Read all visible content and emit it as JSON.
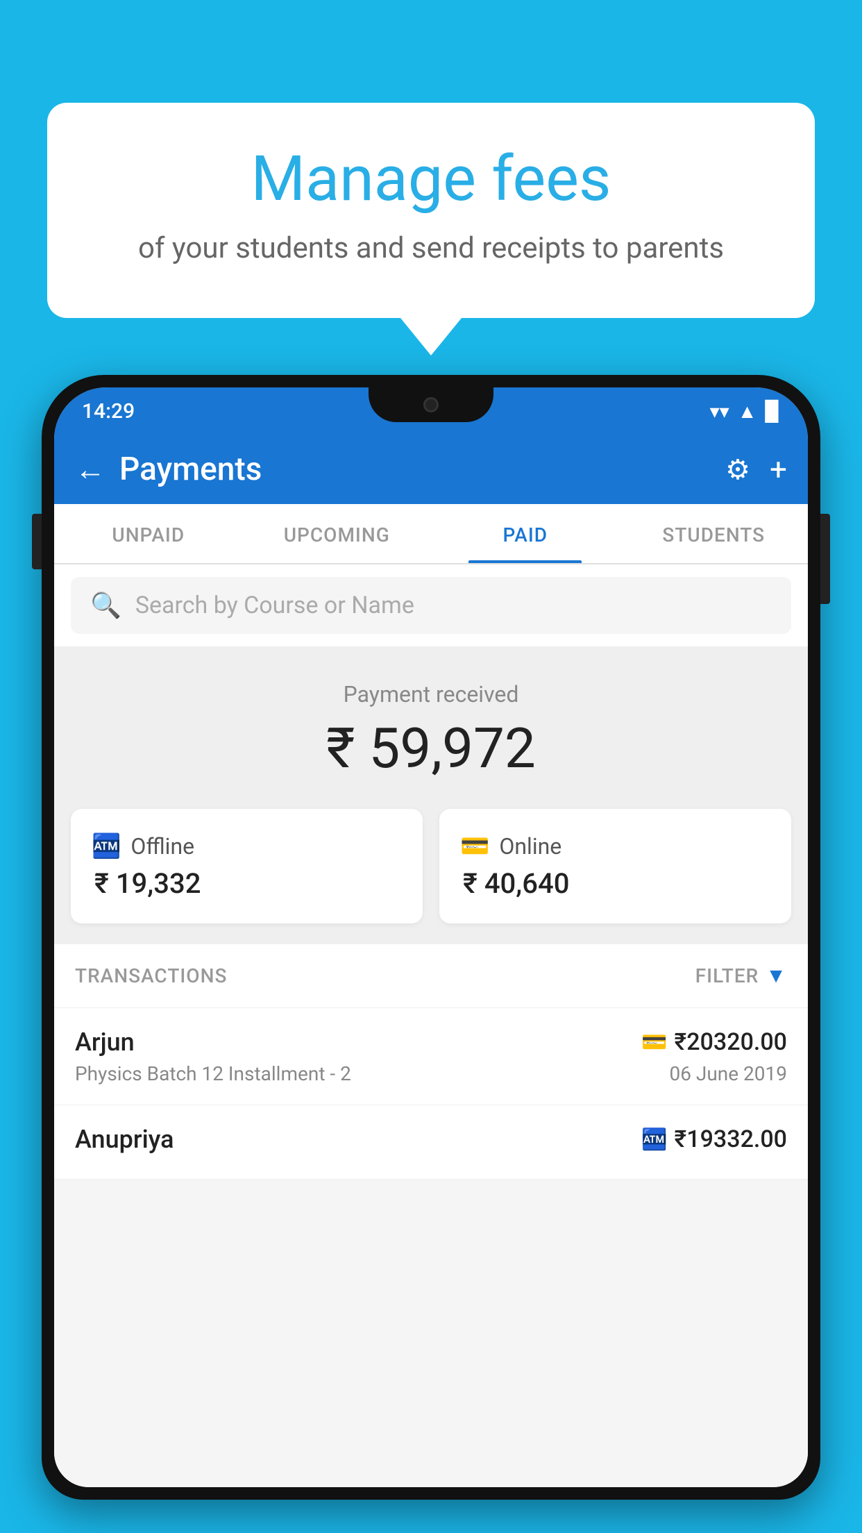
{
  "background_color": "#1ab6e8",
  "speech_bubble": {
    "title": "Manage fees",
    "subtitle": "of your students and send receipts to parents"
  },
  "status_bar": {
    "time": "14:29"
  },
  "header": {
    "title": "Payments",
    "back_label": "←",
    "gear_label": "⚙",
    "plus_label": "+"
  },
  "tabs": [
    {
      "label": "UNPAID",
      "active": false
    },
    {
      "label": "UPCOMING",
      "active": false
    },
    {
      "label": "PAID",
      "active": true
    },
    {
      "label": "STUDENTS",
      "active": false
    }
  ],
  "search": {
    "placeholder": "Search by Course or Name"
  },
  "payment_received": {
    "label": "Payment received",
    "amount": "₹ 59,972",
    "offline": {
      "type": "Offline",
      "amount": "₹ 19,332"
    },
    "online": {
      "type": "Online",
      "amount": "₹ 40,640"
    }
  },
  "transactions": {
    "header_label": "TRANSACTIONS",
    "filter_label": "FILTER",
    "rows": [
      {
        "name": "Arjun",
        "course": "Physics Batch 12 Installment - 2",
        "amount": "₹20320.00",
        "date": "06 June 2019",
        "mode_icon": "card"
      },
      {
        "name": "Anupriya",
        "course": "",
        "amount": "₹19332.00",
        "date": "",
        "mode_icon": "cash"
      }
    ]
  }
}
